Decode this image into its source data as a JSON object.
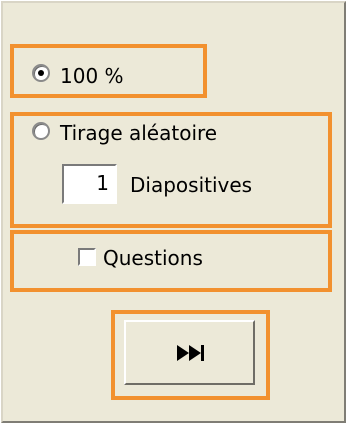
{
  "options": {
    "full_label": "100 %",
    "random_label": "Tirage aléatoire",
    "slides_count": "1",
    "slides_label": "Diapositives",
    "questions_label": "Questions"
  },
  "controls": {
    "play_icon": "fast-forward-icon"
  },
  "colors": {
    "highlight": "#f2912f",
    "panel": "#ece9d8"
  }
}
